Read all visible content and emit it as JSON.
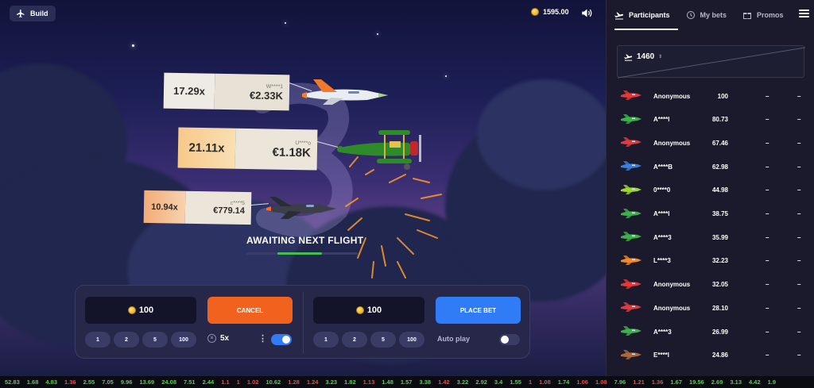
{
  "topbar": {
    "build_label": "Build",
    "balance": "1595.00"
  },
  "flight": {
    "status": "AWAITING NEXT FLIGHT",
    "progress": 0.4,
    "banners": [
      {
        "multiplier": "17.29x",
        "user": "W****1",
        "amount": "€2.33K"
      },
      {
        "multiplier": "21.11x",
        "user": "U****o",
        "amount": "€1.18K"
      },
      {
        "multiplier": "10.94x",
        "user": "c****5",
        "amount": "€779.14"
      }
    ]
  },
  "bet_left": {
    "amount": "100",
    "action": "CANCEL",
    "chips": [
      "1",
      "2",
      "5",
      "100"
    ],
    "auto_multiplier": "5x",
    "toggle_on": true
  },
  "bet_right": {
    "amount": "100",
    "action": "PLACE BET",
    "chips": [
      "1",
      "2",
      "5",
      "100"
    ],
    "autoplay_label": "Auto play",
    "toggle_on": false
  },
  "sidebar": {
    "tabs": [
      "Participants",
      "My bets",
      "Promos"
    ],
    "participants_count": "1460",
    "rows": [
      {
        "name": "Anonymous",
        "value": "100",
        "d1": "–",
        "d2": "–",
        "color": "#e03a3a"
      },
      {
        "name": "A****l",
        "value": "80.73",
        "d1": "–",
        "d2": "–",
        "color": "#3fb04a"
      },
      {
        "name": "Anonymous",
        "value": "67.46",
        "d1": "–",
        "d2": "–",
        "color": "#e03a3a"
      },
      {
        "name": "A****B",
        "value": "62.98",
        "d1": "–",
        "d2": "–",
        "color": "#3a7fe0"
      },
      {
        "name": "0****0",
        "value": "44.98",
        "d1": "–",
        "d2": "–",
        "color": "#9ad82a"
      },
      {
        "name": "A****l",
        "value": "38.75",
        "d1": "–",
        "d2": "–",
        "color": "#3fb04a"
      },
      {
        "name": "A****3",
        "value": "35.99",
        "d1": "–",
        "d2": "–",
        "color": "#3fb04a"
      },
      {
        "name": "L****3",
        "value": "32.23",
        "d1": "–",
        "d2": "–",
        "color": "#f08a2a"
      },
      {
        "name": "Anonymous",
        "value": "32.05",
        "d1": "–",
        "d2": "–",
        "color": "#e03a3a"
      },
      {
        "name": "Anonymous",
        "value": "28.10",
        "d1": "–",
        "d2": "–",
        "color": "#e03a3a"
      },
      {
        "name": "A****3",
        "value": "26.99",
        "d1": "–",
        "d2": "–",
        "color": "#3fb04a"
      },
      {
        "name": "E****l",
        "value": "24.86",
        "d1": "–",
        "d2": "–",
        "color": "#b0683a"
      }
    ]
  },
  "ticker": [
    {
      "v": "52.83",
      "c": "#4fd34f"
    },
    {
      "v": "1.68",
      "c": "#4fd34f"
    },
    {
      "v": "4.83",
      "c": "#4fd34f"
    },
    {
      "v": "1.36",
      "c": "#e84a4a"
    },
    {
      "v": "2.55",
      "c": "#4fd34f"
    },
    {
      "v": "7.05",
      "c": "#4fd34f"
    },
    {
      "v": "9.96",
      "c": "#4fd34f"
    },
    {
      "v": "13.69",
      "c": "#4fd34f"
    },
    {
      "v": "24.08",
      "c": "#4fd34f"
    },
    {
      "v": "7.51",
      "c": "#4fd34f"
    },
    {
      "v": "2.44",
      "c": "#4fd34f"
    },
    {
      "v": "1.1",
      "c": "#e84a4a"
    },
    {
      "v": "1",
      "c": "#e84a4a"
    },
    {
      "v": "1.02",
      "c": "#e84a4a"
    },
    {
      "v": "10.62",
      "c": "#4fd34f"
    },
    {
      "v": "1.28",
      "c": "#e84a4a"
    },
    {
      "v": "1.24",
      "c": "#e84a4a"
    },
    {
      "v": "3.23",
      "c": "#4fd34f"
    },
    {
      "v": "1.82",
      "c": "#4fd34f"
    },
    {
      "v": "1.13",
      "c": "#e84a4a"
    },
    {
      "v": "1.48",
      "c": "#4fd34f"
    },
    {
      "v": "1.57",
      "c": "#4fd34f"
    },
    {
      "v": "3.38",
      "c": "#4fd34f"
    },
    {
      "v": "1.42",
      "c": "#e84a4a"
    },
    {
      "v": "3.22",
      "c": "#4fd34f"
    },
    {
      "v": "2.92",
      "c": "#4fd34f"
    },
    {
      "v": "3.4",
      "c": "#4fd34f"
    },
    {
      "v": "1.55",
      "c": "#4fd34f"
    },
    {
      "v": "1",
      "c": "#e84a4a"
    },
    {
      "v": "1.08",
      "c": "#e84a4a"
    },
    {
      "v": "1.74",
      "c": "#4fd34f"
    },
    {
      "v": "1.06",
      "c": "#e84a4a"
    },
    {
      "v": "1.08",
      "c": "#e84a4a"
    },
    {
      "v": "7.96",
      "c": "#4fd34f"
    },
    {
      "v": "1.21",
      "c": "#e84a4a"
    },
    {
      "v": "1.36",
      "c": "#e84a4a"
    },
    {
      "v": "1.67",
      "c": "#4fd34f"
    },
    {
      "v": "19.56",
      "c": "#4fd34f"
    },
    {
      "v": "2.69",
      "c": "#4fd34f"
    },
    {
      "v": "3.13",
      "c": "#4fd34f"
    },
    {
      "v": "4.42",
      "c": "#4fd34f"
    },
    {
      "v": "1.9",
      "c": "#4fd34f"
    }
  ]
}
